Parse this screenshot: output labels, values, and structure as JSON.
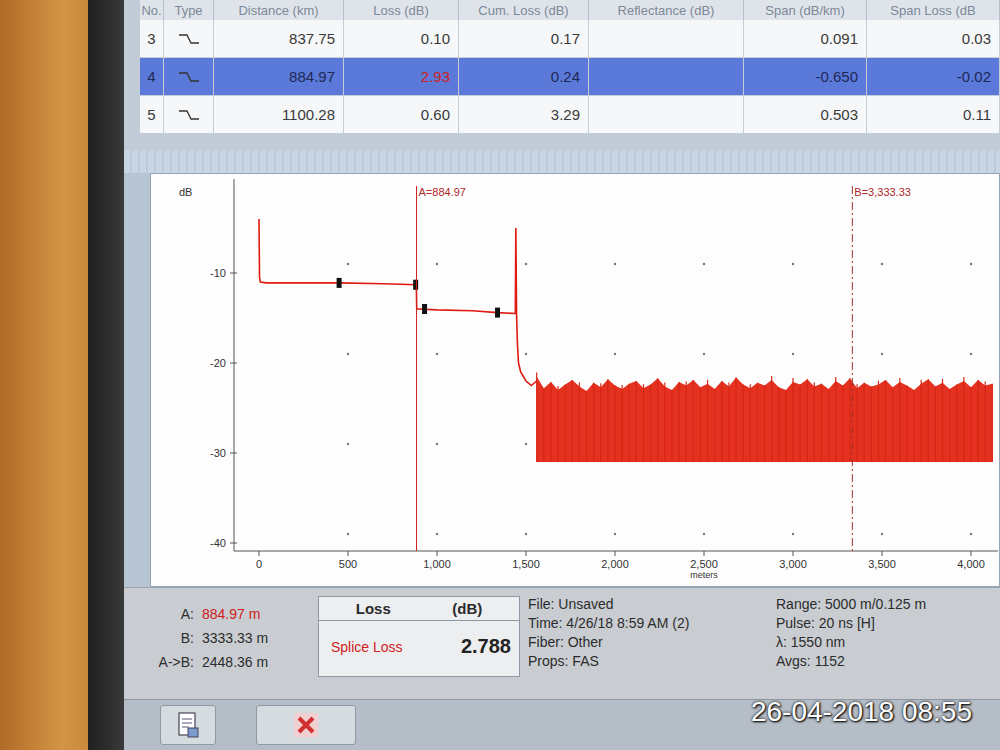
{
  "table": {
    "columns": [
      "No.",
      "Type",
      "Distance (km)",
      "Loss (dB)",
      "Cum. Loss (dB)",
      "Reflectance (dB)",
      "Span (dB/km)",
      "Span Loss (dB"
    ],
    "rows": [
      {
        "no": "3",
        "distance": "837.75",
        "loss": "0.10",
        "cum_loss": "0.17",
        "reflectance": "",
        "span": "0.091",
        "span_loss": "0.03",
        "selected": false,
        "loss_highlighted": false
      },
      {
        "no": "4",
        "distance": "884.97",
        "loss": "2.93",
        "cum_loss": "0.24",
        "reflectance": "",
        "span": "-0.650",
        "span_loss": "-0.02",
        "selected": true,
        "loss_highlighted": true
      },
      {
        "no": "5",
        "distance": "1100.28",
        "loss": "0.60",
        "cum_loss": "3.29",
        "reflectance": "",
        "span": "0.503",
        "span_loss": "0.11",
        "selected": false,
        "loss_highlighted": false
      }
    ]
  },
  "chart": {
    "y_unit": "dB",
    "y_ticks": [
      {
        "label": "-10",
        "value": -10
      },
      {
        "label": "-20",
        "value": -20
      },
      {
        "label": "-30",
        "value": -30
      },
      {
        "label": "-40",
        "value": -40
      }
    ],
    "x_ticks": [
      {
        "label": "0",
        "value": 0
      },
      {
        "label": "500",
        "value": 500
      },
      {
        "label": "1,000",
        "value": 1000
      },
      {
        "label": "1,500",
        "value": 1500
      },
      {
        "label": "2,000",
        "value": 2000
      },
      {
        "label": "2,500",
        "value": 2500
      },
      {
        "label": "3,000",
        "value": 3000
      },
      {
        "label": "3,500",
        "value": 3500
      },
      {
        "label": "4,000",
        "value": 4000
      }
    ],
    "x_unit": "meters",
    "trace": {
      "distance_m": [
        0,
        3,
        8,
        40,
        200,
        450,
        700,
        884,
        886,
        900,
        1000,
        1200,
        1340,
        1440,
        1443,
        1447,
        1452,
        1458,
        1470,
        1500,
        1530,
        1560
      ],
      "level_db": [
        -4.0,
        -10.5,
        -11.0,
        -11.1,
        -11.1,
        -11.1,
        -11.2,
        -11.3,
        -14.0,
        -14.0,
        -14.1,
        -14.2,
        -14.4,
        -14.5,
        -5.0,
        -14.6,
        -18.0,
        -20.0,
        -21.0,
        -22.0,
        -22.5,
        -22.0
      ]
    },
    "noise": {
      "start_m": 1560,
      "step_m": 40,
      "floor_db": -31,
      "peaks_db": [
        -21.5,
        -22.8,
        -22.1,
        -23.0,
        -22.4,
        -21.9,
        -22.6,
        -23.1,
        -22.2,
        -22.7,
        -21.8,
        -22.5,
        -22.9,
        -22.3,
        -22.0,
        -22.8,
        -22.4,
        -21.7,
        -22.6,
        -23.0,
        -22.1,
        -22.5,
        -21.9,
        -22.7,
        -22.3,
        -22.9,
        -22.0,
        -22.6,
        -21.6,
        -22.4,
        -22.8,
        -22.2,
        -22.5,
        -21.9,
        -22.7,
        -23.0,
        -22.1,
        -22.4,
        -21.8,
        -22.6,
        -22.3,
        -22.9,
        -22.0,
        -22.5,
        -21.7,
        -22.8,
        -22.2,
        -22.6,
        -22.4,
        -21.9,
        -22.7,
        -22.1,
        -22.5,
        -23.0,
        -22.3,
        -21.8,
        -22.6,
        -22.2,
        -22.9,
        -22.4,
        -22.0,
        -22.7,
        -21.9,
        -22.5,
        -22.3
      ]
    },
    "event_marks": [
      {
        "distance_m": 450,
        "level_db": -11.1
      },
      {
        "distance_m": 880,
        "level_db": -11.3
      },
      {
        "distance_m": 930,
        "level_db": -14.0
      },
      {
        "distance_m": 1340,
        "level_db": -14.4
      }
    ],
    "cursors": [
      {
        "label": "A=884.97",
        "position_m": 884.97,
        "dashed": false
      },
      {
        "label": "B=3,333.33",
        "position_m": 3333.33,
        "dashed": true
      }
    ]
  },
  "readouts": [
    {
      "label": "A:",
      "value": "884.97 m",
      "highlighted": true
    },
    {
      "label": "B:",
      "value": "3333.33 m",
      "highlighted": false
    },
    {
      "label": "A->B:",
      "value": "2448.36 m",
      "highlighted": false
    }
  ],
  "loss_box": {
    "title": "Loss",
    "unit": "(dB)",
    "label": "Splice Loss",
    "value": "2.788"
  },
  "file_info": [
    "File: Unsaved",
    "Time: 4/26/18 8:59 AM (2)",
    "Fiber: Other",
    "Props: FAS"
  ],
  "acquisition": [
    "Range: 5000 m/0.125 m",
    "Pulse: 20 ns [H]",
    "λ: 1550 nm",
    "Avgs: 1152"
  ],
  "timestamp": "26-04-2018 08:55"
}
